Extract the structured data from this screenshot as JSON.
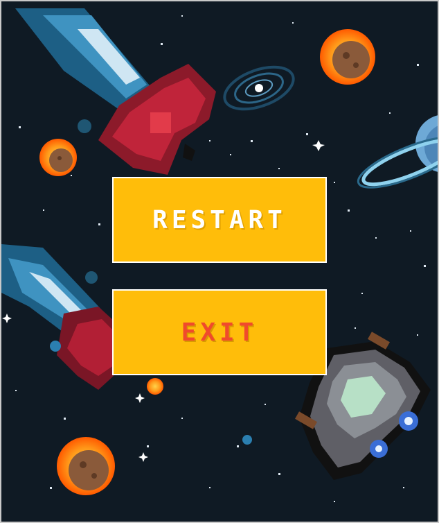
{
  "menu": {
    "restart_label": "RESTART",
    "exit_label": "EXIT"
  },
  "colors": {
    "background": "#0f1a24",
    "button_fill": "#ffbd0a",
    "restart_text": "#ffffff",
    "exit_text": "#f04a2c"
  },
  "sprites": {
    "meteor": "flaming-meteor-icon",
    "ship": "spaceship-icon",
    "planet": "ringed-planet-icon",
    "galaxy": "spiral-galaxy-icon"
  }
}
